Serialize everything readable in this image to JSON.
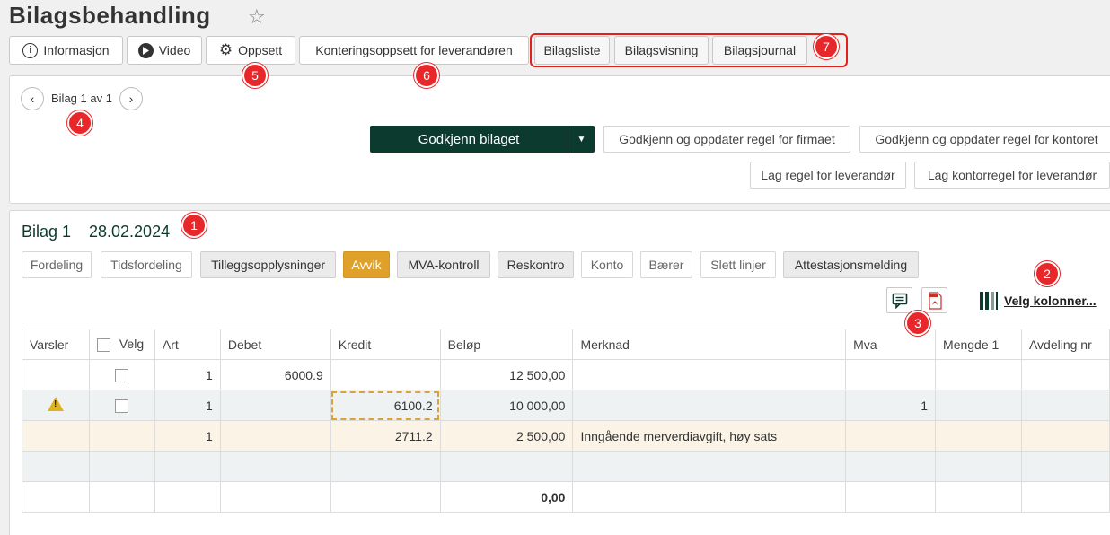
{
  "page": {
    "title": "Bilagsbehandling"
  },
  "toolbar": {
    "informasjon": "Informasjon",
    "video": "Video",
    "oppsett": "Oppsett",
    "kontering": "Konteringsoppsett for leverandøren",
    "bilagsliste": "Bilagsliste",
    "bilagsvisning": "Bilagsvisning",
    "bilagsjournal": "Bilagsjournal"
  },
  "badges": [
    "1",
    "2",
    "3",
    "4",
    "5",
    "6",
    "7"
  ],
  "nav": {
    "counter": "Bilag 1 av 1"
  },
  "actions": {
    "approve": "Godkjenn bilaget",
    "approve_firm": "Godkjenn og oppdater regel for firmaet",
    "approve_office": "Godkjenn og oppdater regel for kontoret",
    "rule_supplier": "Lag regel for leverandør",
    "office_rule_supplier": "Lag kontorregel for leverandør"
  },
  "voucher": {
    "label": "Bilag 1",
    "date": "28.02.2024"
  },
  "tabs": [
    "Fordeling",
    "Tidsfordeling",
    "Tilleggsopplysninger",
    "Avvik",
    "MVA-kontroll",
    "Reskontro",
    "Konto",
    "Bærer",
    "Slett linjer",
    "Attestasjonsmelding"
  ],
  "columns_link": "Velg kolonner...",
  "table": {
    "headers": [
      "Varsler",
      "Velg",
      "Art",
      "Debet",
      "Kredit",
      "Beløp",
      "Merknad",
      "Mva",
      "Mengde 1",
      "Avdeling nr"
    ],
    "rows": [
      {
        "art": "1",
        "debet": "6000.9",
        "kredit": "",
        "belop": "12 500,00",
        "merknad": "",
        "mva": ""
      },
      {
        "art": "1",
        "debet": "",
        "kredit": "6100.2",
        "belop": "10 000,00",
        "merknad": "",
        "mva": "1"
      },
      {
        "art": "1",
        "debet": "",
        "kredit": "2711.2",
        "belop": "2 500,00",
        "merknad": "Inngående merverdiavgift, høy sats",
        "mva": ""
      }
    ],
    "total": "0,00"
  },
  "colors": {
    "brand": "#0d3a2f",
    "accent": "#e0a12a",
    "badge": "#e8272a"
  }
}
